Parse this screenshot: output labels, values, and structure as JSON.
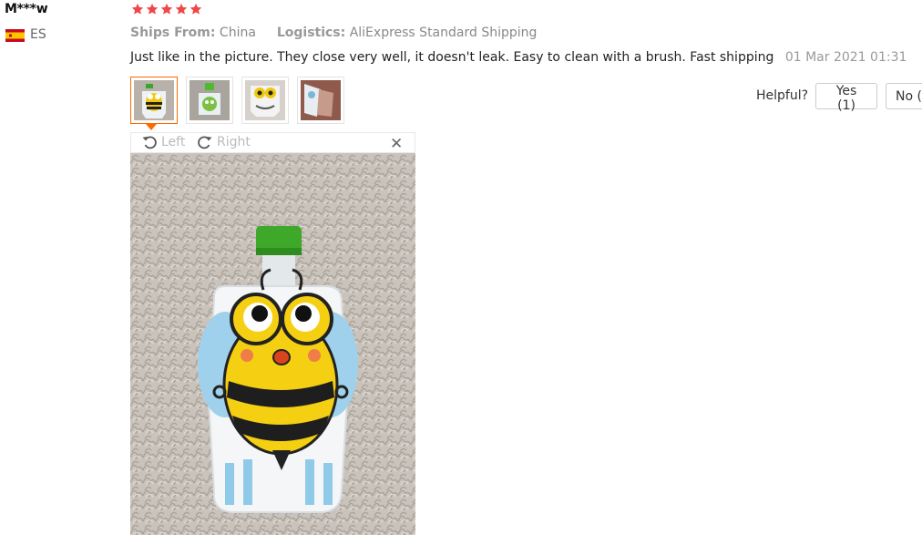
{
  "reviewer": {
    "name": "M***w",
    "country": "ES",
    "flag_icon": "spain-flag-icon"
  },
  "rating": {
    "stars": 5,
    "max": 5,
    "color": "#f04848"
  },
  "shipping": {
    "ships_from_label": "Ships From:",
    "ships_from_value": "China",
    "logistics_label": "Logistics:",
    "logistics_value": "AliExpress Standard Shipping"
  },
  "review": {
    "text": "Just like in the picture. They close very well, it doesn't leak. Easy to clean with a brush. Fast shipping",
    "date": "01 Mar 2021 01:31"
  },
  "photos": {
    "count": 4,
    "selected_index": 0,
    "accent": "#ff6a00"
  },
  "helpful": {
    "label": "Helpful?",
    "yes_label": "Yes (1)",
    "no_label": "No ("
  },
  "viewer": {
    "rotate_left_label": "Left",
    "rotate_right_label": "Right",
    "close_icon": "close-icon"
  }
}
